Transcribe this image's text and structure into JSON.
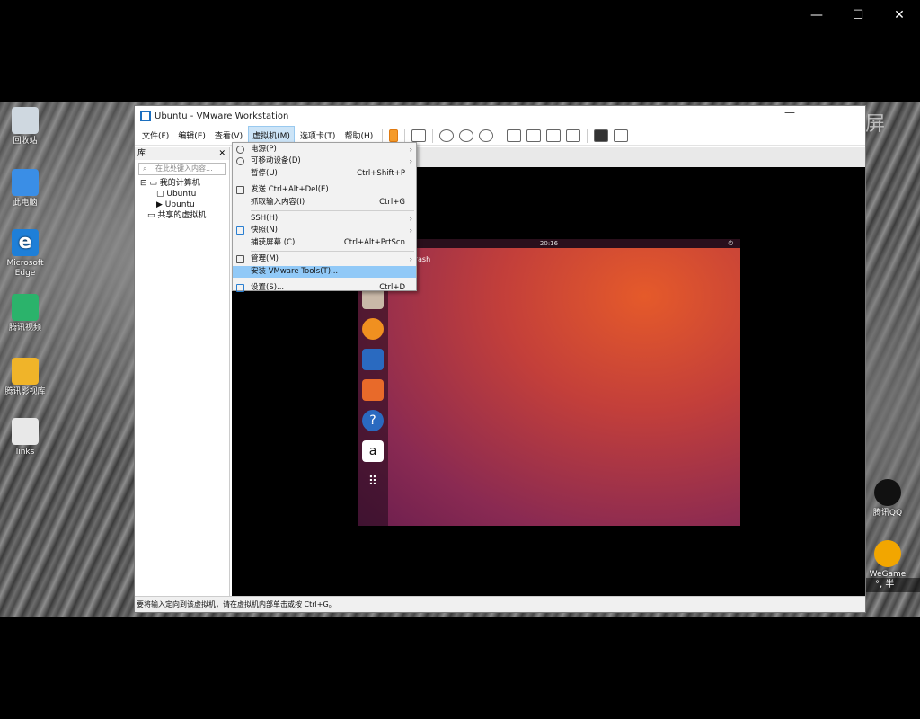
{
  "player": {
    "controls": [
      "—",
      "☐",
      "✕"
    ]
  },
  "watermark": "微软录屏",
  "desktop_icons": [
    {
      "label": "回收站"
    },
    {
      "label": "此电脑"
    },
    {
      "label": "Microsoft Edge"
    },
    {
      "label": "腾讯视频"
    },
    {
      "label": "腾讯影视库"
    },
    {
      "label": "links"
    },
    {
      "label": "腾讯QQ"
    },
    {
      "label": "WeGame"
    }
  ],
  "vmware": {
    "title": "Ubuntu - VMware Workstation",
    "menus": [
      "文件(F)",
      "编辑(E)",
      "查看(V)",
      "虚拟机(M)",
      "选项卡(T)",
      "帮助(H)"
    ],
    "library": {
      "header": "库",
      "search_placeholder": "在此处键入内容...",
      "tree": [
        "我的计算机",
        "Ubuntu",
        "Ubuntu",
        "共享的虚拟机"
      ]
    },
    "status": "要将输入定向到该虚拟机，请在虚拟机内部单击或按 Ctrl+G。"
  },
  "vm_menu": {
    "items": [
      {
        "label": "电源(P)",
        "shortcut": "",
        "arrow": "›"
      },
      {
        "label": "可移动设备(D)",
        "shortcut": "",
        "arrow": "›"
      },
      {
        "label": "暂停(U)",
        "shortcut": "Ctrl+Shift+P",
        "arrow": ""
      },
      {
        "label": "发送 Ctrl+Alt+Del(E)",
        "shortcut": "",
        "arrow": ""
      },
      {
        "label": "抓取输入内容(I)",
        "shortcut": "Ctrl+G",
        "arrow": ""
      },
      {
        "label": "SSH(H)",
        "shortcut": "",
        "arrow": "›"
      },
      {
        "label": "快照(N)",
        "shortcut": "",
        "arrow": "›"
      },
      {
        "label": "捕获屏幕 (C)",
        "shortcut": "Ctrl+Alt+PrtScn",
        "arrow": ""
      },
      {
        "label": "管理(M)",
        "shortcut": "",
        "arrow": "›"
      },
      {
        "label": "安装 VMware Tools(T)...",
        "shortcut": "",
        "arrow": ""
      },
      {
        "label": "设置(S)...",
        "shortcut": "Ctrl+D",
        "arrow": ""
      }
    ]
  },
  "ubuntu": {
    "clock": "20:16",
    "trash_label": "Trash"
  },
  "tray": {
    "text": "°, 半"
  },
  "colors": {
    "accent": "#91c9f7",
    "ubuntu_orange": "#e55a2a",
    "ubuntu_purple": "#6a1e4e"
  }
}
